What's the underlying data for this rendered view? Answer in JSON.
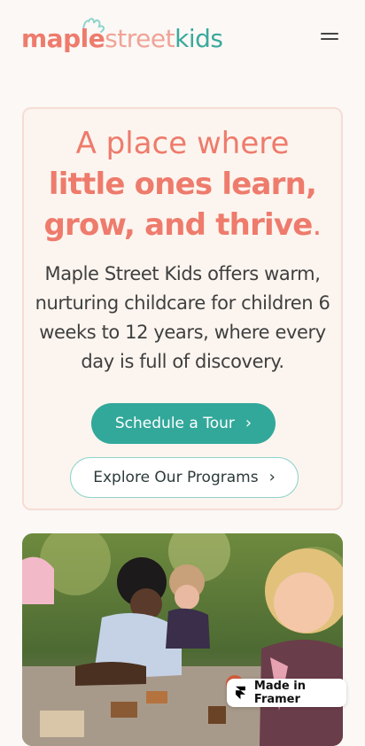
{
  "header": {
    "logo_part1": "maple",
    "logo_part2": "street",
    "logo_part3": "kids",
    "menu_icon": "hamburger-menu-icon"
  },
  "hero": {
    "heading_line1": "A place where",
    "heading_line2": "little ones learn,",
    "heading_line3": "grow, and thrive",
    "heading_period": ".",
    "description": "Maple Street Kids offers warm, nurturing childcare for children 6 weeks to 12 years, where every day is full of discovery.",
    "primary_button": "Schedule a Tour",
    "secondary_button": "Explore Our Programs",
    "chevron_icon": "chevron-right-icon"
  },
  "badge": {
    "label": "Made in Framer",
    "icon": "framer-logo-icon"
  },
  "colors": {
    "coral": "#ee7b6c",
    "teal": "#32a89a",
    "background": "#fbf8f5",
    "card": "#fcf5ef"
  }
}
